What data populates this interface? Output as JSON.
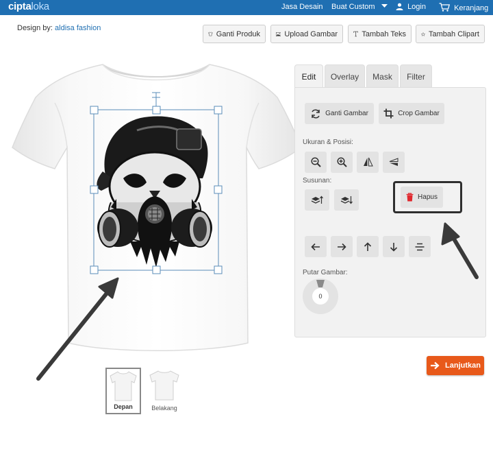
{
  "header": {
    "logo_a": "cipta",
    "logo_b": "loka",
    "nav": [
      "Jasa Desain",
      "Buat Custom",
      "Login",
      "Keranjang"
    ]
  },
  "designer": {
    "prefix": "Design by:",
    "name": "aldisa fashion"
  },
  "toolbar": {
    "change_product": "Ganti Produk",
    "upload_image": "Upload Gambar",
    "add_text": "Tambah Teks",
    "add_clipart": "Tambah Clipart"
  },
  "views": [
    "Depan",
    "Belakang"
  ],
  "editor": {
    "tabs": [
      "Edit",
      "Overlay",
      "Mask",
      "Filter"
    ],
    "change_image": "Ganti Gambar",
    "crop_image": "Crop Gambar",
    "size_position_label": "Ukuran & Posisi:",
    "arrange_label": "Susunan:",
    "delete": "Hapus",
    "rotate_label": "Putar Gambar:",
    "rotate_value": "0"
  },
  "next_button": "Lanjutkan",
  "colors": {
    "header": "#1f6fb2",
    "accent": "#e8591a",
    "delete_icon": "#e0282e"
  }
}
